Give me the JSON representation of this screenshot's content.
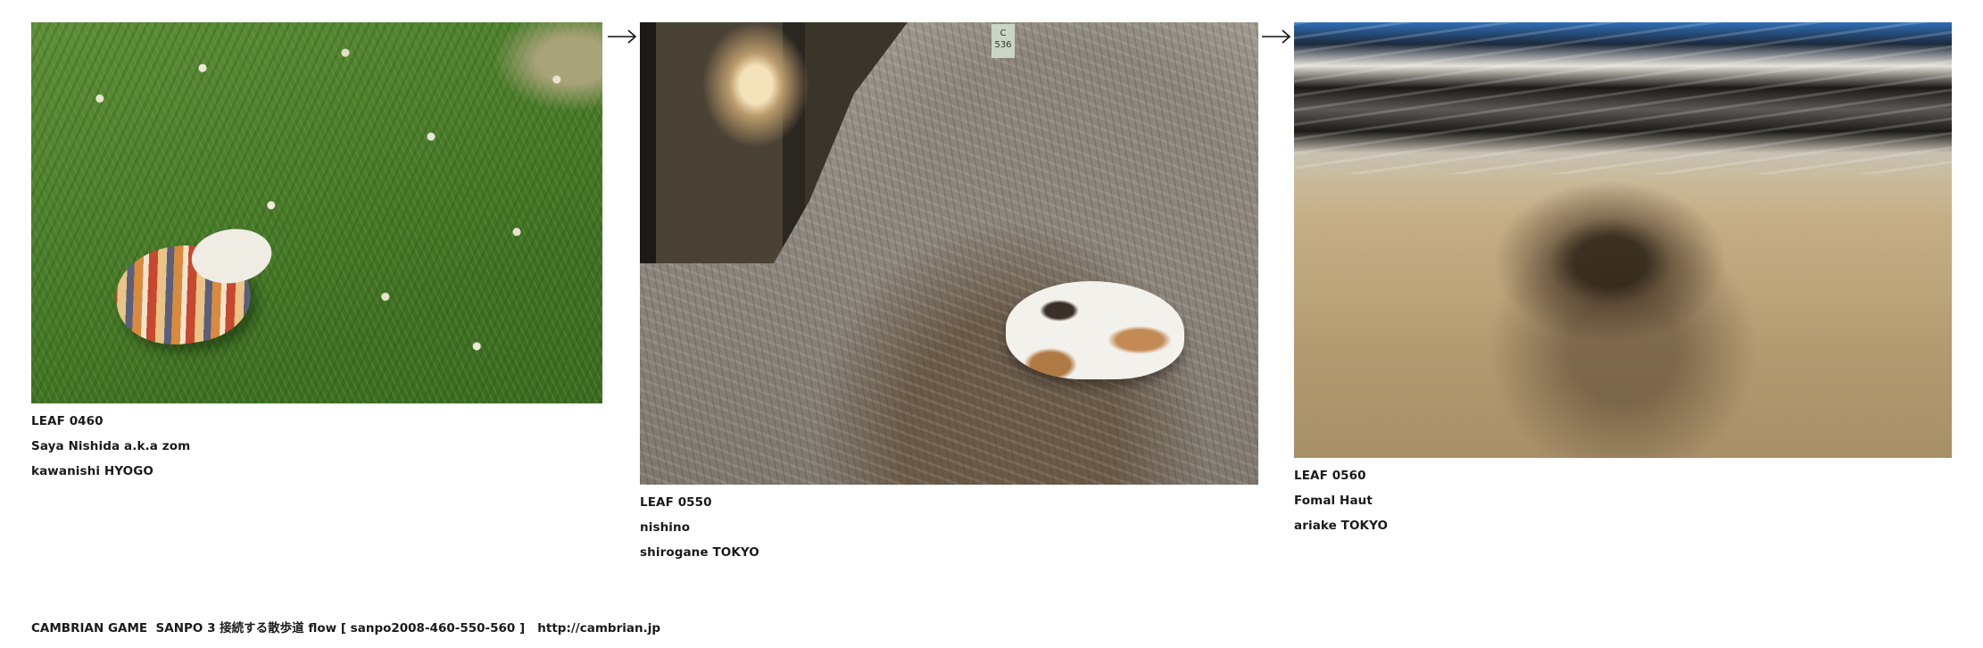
{
  "leaves": [
    {
      "id": "LEAF 0460",
      "author": "Saya Nishida a.k.a zom",
      "location": "kawanishi HYOGO"
    },
    {
      "id": "LEAF 0550",
      "author": "nishino",
      "location": "shirogane TOKYO",
      "sign_text": "C\n536"
    },
    {
      "id": "LEAF 0560",
      "author": "Fomal Haut",
      "location": "ariake TOKYO"
    }
  ],
  "arrows": [
    "arrow-right-icon",
    "arrow-right-icon"
  ],
  "footer": {
    "text": "CAMBRIAN GAME  SANPO 3 接続する散歩道 flow [ sanpo2008-460-550-560 ]   ",
    "link": "http://cambrian.jp"
  }
}
